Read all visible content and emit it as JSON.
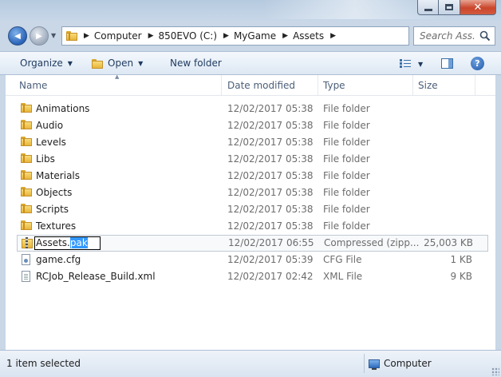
{
  "window": {
    "minimize_icon": "minimize-icon",
    "maximize_icon": "maximize-icon",
    "close_glyph": "✕"
  },
  "nav": {
    "back_glyph": "◀",
    "forward_glyph": "▶",
    "breadcrumbs": [
      "Computer",
      "850EVO (C:)",
      "MyGame",
      "Assets"
    ],
    "search_placeholder": "Search Ass..."
  },
  "toolbar": {
    "organize": "Organize",
    "open": "Open",
    "new_folder": "New folder",
    "help_glyph": "?"
  },
  "columns": {
    "name": "Name",
    "date": "Date modified",
    "type": "Type",
    "size": "Size"
  },
  "files": [
    {
      "name": "Animations",
      "date": "12/02/2017 05:38",
      "type": "File folder",
      "size": "",
      "icon": "folder-icon"
    },
    {
      "name": "Audio",
      "date": "12/02/2017 05:38",
      "type": "File folder",
      "size": "",
      "icon": "folder-icon"
    },
    {
      "name": "Levels",
      "date": "12/02/2017 05:38",
      "type": "File folder",
      "size": "",
      "icon": "folder-icon"
    },
    {
      "name": "Libs",
      "date": "12/02/2017 05:38",
      "type": "File folder",
      "size": "",
      "icon": "folder-icon"
    },
    {
      "name": "Materials",
      "date": "12/02/2017 05:38",
      "type": "File folder",
      "size": "",
      "icon": "folder-icon"
    },
    {
      "name": "Objects",
      "date": "12/02/2017 05:38",
      "type": "File folder",
      "size": "",
      "icon": "folder-icon"
    },
    {
      "name": "Scripts",
      "date": "12/02/2017 05:38",
      "type": "File folder",
      "size": "",
      "icon": "folder-icon"
    },
    {
      "name": "Textures",
      "date": "12/02/2017 05:38",
      "type": "File folder",
      "size": "",
      "icon": "folder-icon"
    },
    {
      "name": "Assets.pak",
      "rename_base": "Assets.",
      "rename_ext": "pak",
      "date": "12/02/2017 06:55",
      "type": "Compressed (zipp...",
      "size": "25,003 KB",
      "icon": "zip-folder-icon",
      "selected": true
    },
    {
      "name": "game.cfg",
      "date": "12/02/2017 05:39",
      "type": "CFG File",
      "size": "1 KB",
      "icon": "cfg-file-icon"
    },
    {
      "name": "RCJob_Release_Build.xml",
      "date": "12/02/2017 02:42",
      "type": "XML File",
      "size": "9 KB",
      "icon": "xml-file-icon"
    }
  ],
  "status": {
    "selection": "1 item selected",
    "location": "Computer"
  },
  "colors": {
    "accent": "#3399ff",
    "frame": "#c9d7e6",
    "close_button": "#c9452b"
  }
}
